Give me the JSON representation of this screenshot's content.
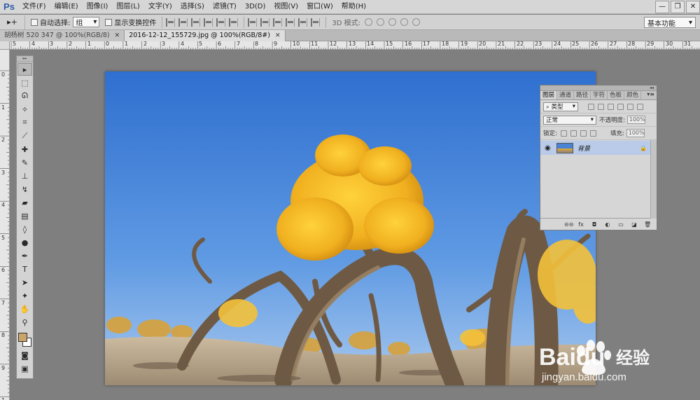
{
  "app": {
    "logo": "Ps"
  },
  "menu": [
    "文件(F)",
    "编辑(E)",
    "图像(I)",
    "图层(L)",
    "文字(Y)",
    "选择(S)",
    "滤镜(T)",
    "3D(D)",
    "视图(V)",
    "窗口(W)",
    "帮助(H)"
  ],
  "window_controls": {
    "minimize": "—",
    "restore": "❐",
    "close": "✕"
  },
  "options": {
    "tool_glyph": "▸+",
    "auto_select_label": "自动选择:",
    "auto_select_value": "组",
    "show_transform_label": "显示变换控件",
    "mode3d_label": "3D 模式:",
    "workspace": "基本功能"
  },
  "tabs": [
    {
      "title": "胡杨树 520 347 @ 100%(RGB/8)",
      "close": "✕"
    },
    {
      "title": "2016-12-12_155729.jpg @ 100%(RGB/8#)",
      "close": "✕"
    }
  ],
  "rulers": {
    "horizontal": [
      "5",
      "4",
      "3",
      "2",
      "1",
      "0",
      "1",
      "2",
      "3",
      "4",
      "5",
      "6",
      "7",
      "8",
      "9",
      "10",
      "11",
      "12",
      "13",
      "14",
      "15",
      "16",
      "17",
      "18",
      "19",
      "20",
      "21",
      "22",
      "23",
      "24",
      "25",
      "26",
      "27",
      "28",
      "29",
      "30",
      "31"
    ],
    "vertical": [
      "0",
      "1",
      "2",
      "3",
      "4",
      "5",
      "6",
      "7",
      "8",
      "9",
      "1"
    ]
  },
  "tools": [
    {
      "name": "move-tool",
      "glyph": "▸"
    },
    {
      "name": "marquee-tool",
      "glyph": "⬚"
    },
    {
      "name": "lasso-tool",
      "glyph": "ᘏ"
    },
    {
      "name": "quick-select-tool",
      "glyph": "✧"
    },
    {
      "name": "crop-tool",
      "glyph": "⌗"
    },
    {
      "name": "eyedropper-tool",
      "glyph": "⟋"
    },
    {
      "name": "healing-brush-tool",
      "glyph": "✚"
    },
    {
      "name": "brush-tool",
      "glyph": "✎"
    },
    {
      "name": "clone-stamp-tool",
      "glyph": "⊥"
    },
    {
      "name": "history-brush-tool",
      "glyph": "↯"
    },
    {
      "name": "eraser-tool",
      "glyph": "▰"
    },
    {
      "name": "gradient-tool",
      "glyph": "▤"
    },
    {
      "name": "blur-tool",
      "glyph": "◊"
    },
    {
      "name": "dodge-tool",
      "glyph": "●"
    },
    {
      "name": "pen-tool",
      "glyph": "✒"
    },
    {
      "name": "type-tool",
      "glyph": "T"
    },
    {
      "name": "path-select-tool",
      "glyph": "➤"
    },
    {
      "name": "shape-tool",
      "glyph": "✦"
    },
    {
      "name": "hand-tool",
      "glyph": "✋"
    },
    {
      "name": "zoom-tool",
      "glyph": "⚲"
    }
  ],
  "colors": {
    "foreground": "#c9a56b",
    "background": "#ffffff",
    "accent": "#2c5aa8"
  },
  "layers_panel": {
    "collapse": "◂◂",
    "tabs": [
      "图层",
      "通道",
      "路径",
      "字符",
      "色板",
      "颜色"
    ],
    "menu": "▾≡",
    "filter_label": "⌕ 类型",
    "blend_mode": "正常",
    "opacity_label": "不透明度:",
    "opacity_value": "100%",
    "lock_label": "锁定:",
    "fill_label": "填充:",
    "fill_value": "100%",
    "layers": [
      {
        "name": "背景",
        "visible": true,
        "locked": true
      }
    ],
    "footer": [
      "⊝⊝",
      "fx",
      "◘",
      "◐",
      "▭",
      "◪",
      "🗑"
    ]
  },
  "watermark": {
    "brand": "Baidu",
    "brand_cn": "经验",
    "url": "jingyan.baidu.com"
  }
}
